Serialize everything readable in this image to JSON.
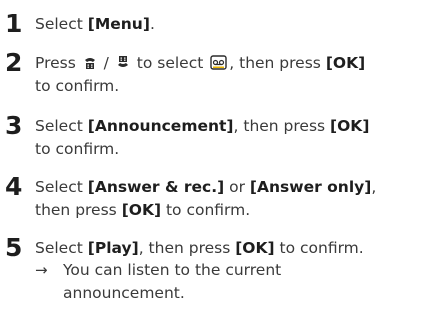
{
  "steps": [
    {
      "number": "1",
      "text_before": "Select ",
      "kw1": "[Menu]",
      "text_after": "."
    },
    {
      "number": "2",
      "press": "Press",
      "slash": "/",
      "to_select": "to select",
      "then_press": ", then press",
      "ok": "[OK]",
      "line2": "to confirm.",
      "icons": [
        "handset-up-icon",
        "handset-down-icon",
        "answering-machine-icon"
      ]
    },
    {
      "number": "3",
      "select": "Select ",
      "kw1": "[Announcement]",
      "then_press": ", then press ",
      "ok": "[OK]",
      "line2": "to confirm."
    },
    {
      "number": "4",
      "select": "Select ",
      "kw1": "[Answer & rec.]",
      "or": " or ",
      "kw2": "[Answer only]",
      "comma": ",",
      "then_press": "then press ",
      "ok": "[OK]",
      "to_confirm": " to confirm."
    },
    {
      "number": "5",
      "select": "Select ",
      "kw1": "[Play]",
      "then_press": ", then press ",
      "ok": "[OK]",
      "to_confirm": " to confirm.",
      "arrow": "→",
      "result_line1": "You can listen to the current",
      "result_line2": "announcement."
    }
  ]
}
